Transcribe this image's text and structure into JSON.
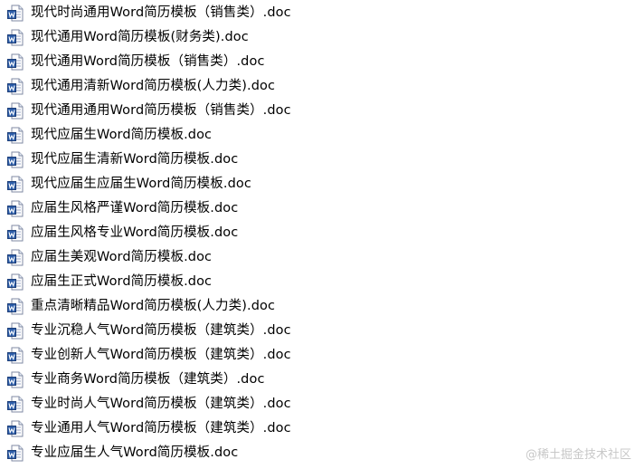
{
  "file_icon": "word-document-icon",
  "files": [
    "现代时尚通用Word简历模板（销售类）.doc",
    "现代通用Word简历模板(财务类).doc",
    "现代通用Word简历模板（销售类）.doc",
    "现代通用清新Word简历模板(人力类).doc",
    "现代通用通用Word简历模板（销售类）.doc",
    "现代应届生Word简历模板.doc",
    "现代应届生清新Word简历模板.doc",
    "现代应届生应届生Word简历模板.doc",
    "应届生风格严谨Word简历模板.doc",
    "应届生风格专业Word简历模板.doc",
    "应届生美观Word简历模板.doc",
    "应届生正式Word简历模板.doc",
    "重点清晰精品Word简历模板(人力类).doc",
    "专业沉稳人气Word简历模板（建筑类）.doc",
    "专业创新人气Word简历模板（建筑类）.doc",
    "专业商务Word简历模板（建筑类）.doc",
    "专业时尚人气Word简历模板（建筑类）.doc",
    "专业通用人气Word简历模板（建筑类）.doc",
    "专业应届生人气Word简历模板.doc"
  ],
  "watermark": "@稀土掘金技术社区"
}
